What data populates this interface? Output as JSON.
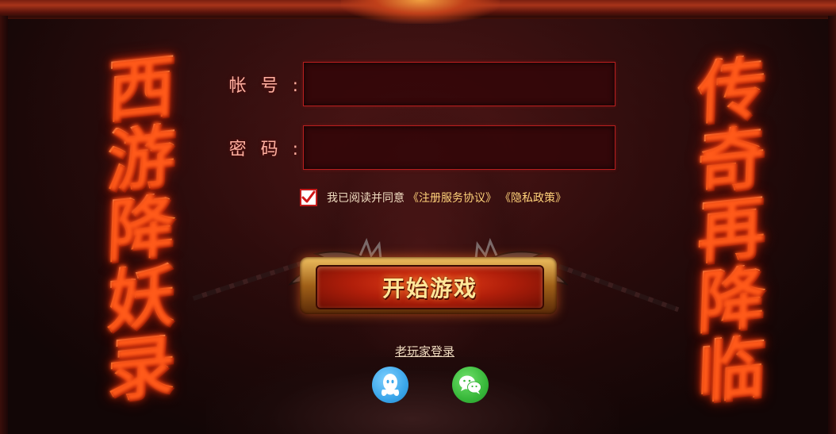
{
  "titles": {
    "left": [
      "西",
      "游",
      "降",
      "妖",
      "录"
    ],
    "right": [
      "传",
      "奇",
      "再",
      "降",
      "临"
    ]
  },
  "form": {
    "account_label": "帐号",
    "password_label": "密码",
    "colon": ":",
    "account_value": "",
    "password_value": ""
  },
  "agreement": {
    "checked": true,
    "text": "我已阅读并同意",
    "terms_link": "《注册服务协议》",
    "privacy_link": "《隐私政策》"
  },
  "start_button": {
    "label": "开始游戏"
  },
  "old_player_link": "老玩家登录",
  "social": {
    "qq_icon": "qq-icon",
    "wechat_icon": "wechat-icon"
  },
  "colors": {
    "input_border": "#b81e1e",
    "checkbox_border": "#c21a1a",
    "qq": "#3ba6ea",
    "wechat": "#38b83a"
  }
}
